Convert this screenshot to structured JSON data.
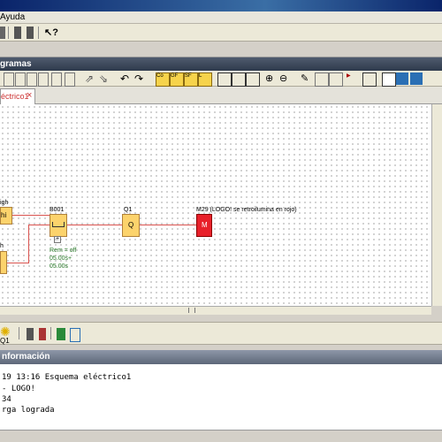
{
  "menu": {
    "help": "Ayuda"
  },
  "panels": {
    "diagrams": "gramas",
    "info": "nformación"
  },
  "tabs": [
    {
      "label": "éctrico1",
      "close": "×"
    }
  ],
  "diagram": {
    "input1_label": "igh",
    "input1_symbol": "hi",
    "input2_label": "h",
    "timer_name": "B001",
    "timer_rem": "Rem = off",
    "timer_on": "05.00s+",
    "timer_off": "05.00s",
    "output_name": "Q1",
    "output_symbol": "Q",
    "marker_name": "M29 (LOGO! se retroilumina en rojo)",
    "marker_symbol": "M",
    "expand_marker": "+"
  },
  "bottom_toolbar": {
    "q1_label": "Q1"
  },
  "info_lines": [
    "19 13:16 Esquema eléctrico1",
    "- LOGO!",
    "34",
    "rga lograda"
  ],
  "colors": {
    "wire": "#d9534f",
    "block": "#fcd36c",
    "marker": "#e8202a",
    "output_label": "#2a7a2a"
  }
}
